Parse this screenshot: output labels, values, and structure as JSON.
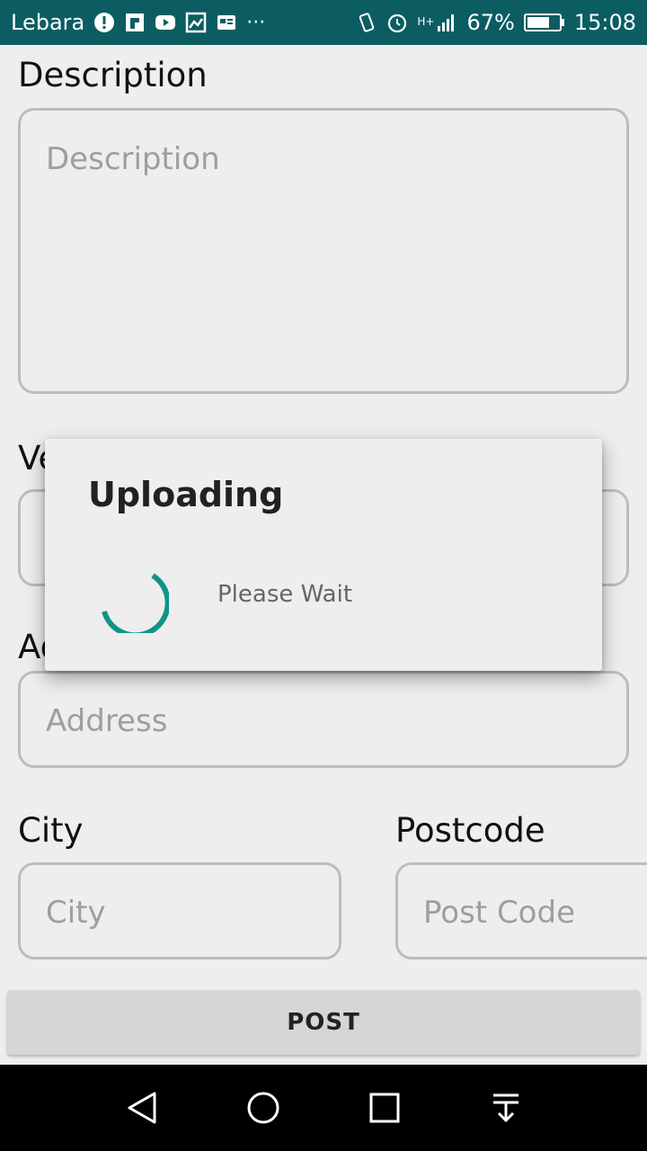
{
  "status_bar": {
    "carrier": "Lebara",
    "battery": "67%",
    "time": "15:08",
    "network": "H+",
    "icons": [
      "alert-icon",
      "flipboard-icon",
      "youtube-icon",
      "gallery-icon",
      "news-icon",
      "more-icon",
      "vibrate-icon",
      "alarm-icon",
      "signal-icon",
      "battery-icon"
    ]
  },
  "form": {
    "description_label": "Description",
    "description_placeholder": "Description",
    "vehicle_label_partial": "Ve",
    "address_label_partial": "Ad",
    "address_placeholder": "Address",
    "city_label": "City",
    "city_placeholder": "City",
    "postcode_label": "Postcode",
    "postcode_placeholder": "Post Code",
    "post_button": "POST"
  },
  "dialog": {
    "title": "Uploading",
    "message": "Please Wait",
    "spinner_color": "#0f9488"
  },
  "nav": {
    "icons": [
      "back-icon",
      "home-icon",
      "recents-icon",
      "notifications-pull-icon"
    ]
  }
}
